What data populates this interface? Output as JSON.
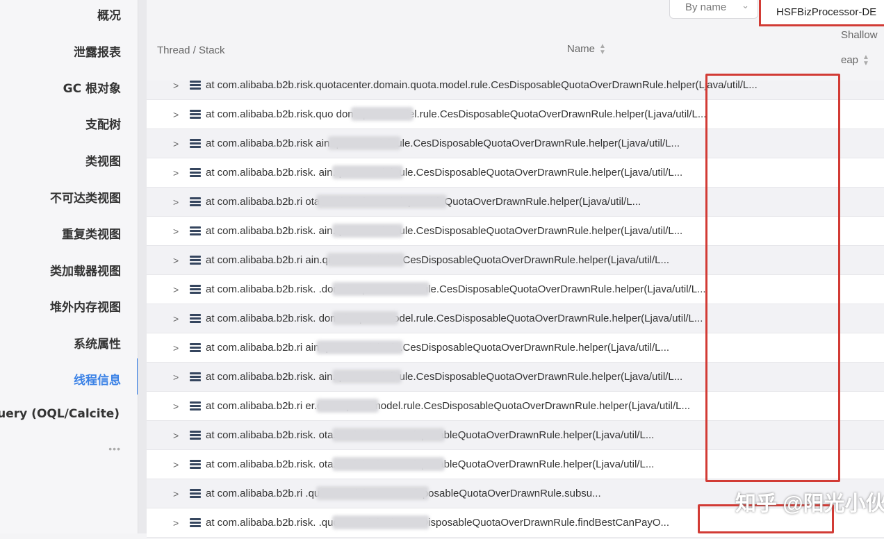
{
  "sidebar": {
    "items": [
      {
        "label": "概况"
      },
      {
        "label": "泄露报表"
      },
      {
        "label": "GC 根对象"
      },
      {
        "label": "支配树"
      },
      {
        "label": "类视图"
      },
      {
        "label": "不可达类视图"
      },
      {
        "label": "重复类视图"
      },
      {
        "label": "类加载器视图"
      },
      {
        "label": "堆外内存视图"
      },
      {
        "label": "系统属性"
      },
      {
        "label": "线程信息"
      },
      {
        "label": "Query (OQL/Calcite)"
      }
    ],
    "active_index": 10,
    "more_label": "•••",
    "accent_color": "#3b82e6"
  },
  "header": {
    "sort_select_value": "By name",
    "thread_filter_value": "HSFBizProcessor-DE"
  },
  "table": {
    "columns": {
      "thread_stack": "Thread / Stack",
      "name": "Name",
      "shallow": "Shallow",
      "heap": "eap"
    },
    "rows": [
      {
        "text": "at com.alibaba.b2b.risk.quotacenter.domain.quota.model.rule.CesDisposableQuotaOverDrawnRule.helper(Ljava/util/L..."
      },
      {
        "text": "at com.alibaba.b2b.risk.quo                     don    .quota.model.rule.CesDisposableQuotaOverDrawnRule.helper(Ljava/util/L..."
      },
      {
        "text": "at com.alibaba.b2b.risk                              ain.quota.model.rule.CesDisposableQuotaOverDrawnRule.helper(Ljava/util/L..."
      },
      {
        "text": "at com.alibaba.b2b.risk.                             ain.quota.model.rule.CesDisposableQuotaOverDrawnRule.helper(Ljava/util/L..."
      },
      {
        "text": "at com.alibaba.b2b.ri                                   ota.model.rule.CesDisposableQuotaOverDrawnRule.helper(Ljava/util/L..."
      },
      {
        "text": "at com.alibaba.b2b.risk.                             ain.quota.model.rule.CesDisposableQuotaOverDrawnRule.helper(Ljava/util/L..."
      },
      {
        "text": "at com.alibaba.b2b.ri                                ain.quota.model.rule.CesDisposableQuotaOverDrawnRule.helper(Ljava/util/L..."
      },
      {
        "text": "at com.alibaba.b2b.risk.                 .domain.quota.model.rule.CesDisposableQuotaOverDrawnRule.helper(Ljava/util/L..."
      },
      {
        "text": "at com.alibaba.b2b.risk.                domain.quota.model.rule.CesDisposableQuotaOverDrawnRule.helper(Ljava/util/L..."
      },
      {
        "text": "at com.alibaba.b2b.ri                                ain.quota.model.rule.CesDisposableQuotaOverDrawnRule.helper(Ljava/util/L..."
      },
      {
        "text": "at com.alibaba.b2b.risk.                             ain.quota.model.rule.CesDisposableQuotaOverDrawnRule.helper(Ljava/util/L..."
      },
      {
        "text": "at com.alibaba.b2b.ri                       er.dom    .quota.model.rule.CesDisposableQuotaOverDrawnRule.helper(Ljava/util/L..."
      },
      {
        "text": "at com.alibaba.b2b.risk.                                ota.model.rule.CesDisposableQuotaOverDrawnRule.helper(Ljava/util/L..."
      },
      {
        "text": "at com.alibaba.b2b.risk.                                ota.model.rule.CesDisposableQuotaOverDrawnRule.helper(Ljava/util/L..."
      },
      {
        "text": "at com.alibaba.b2b.ri                                   .quota.model.rule.CesDisposableQuotaOverDrawnRule.subsu..."
      },
      {
        "text": "at com.alibaba.b2b.risk.                                 .quota.model.rule.CesDisposableQuotaOverDrawnRule.findBestCanPayO..."
      }
    ]
  },
  "watermark": "知乎 @阳光小伙",
  "highlight_color": "#d23b35"
}
